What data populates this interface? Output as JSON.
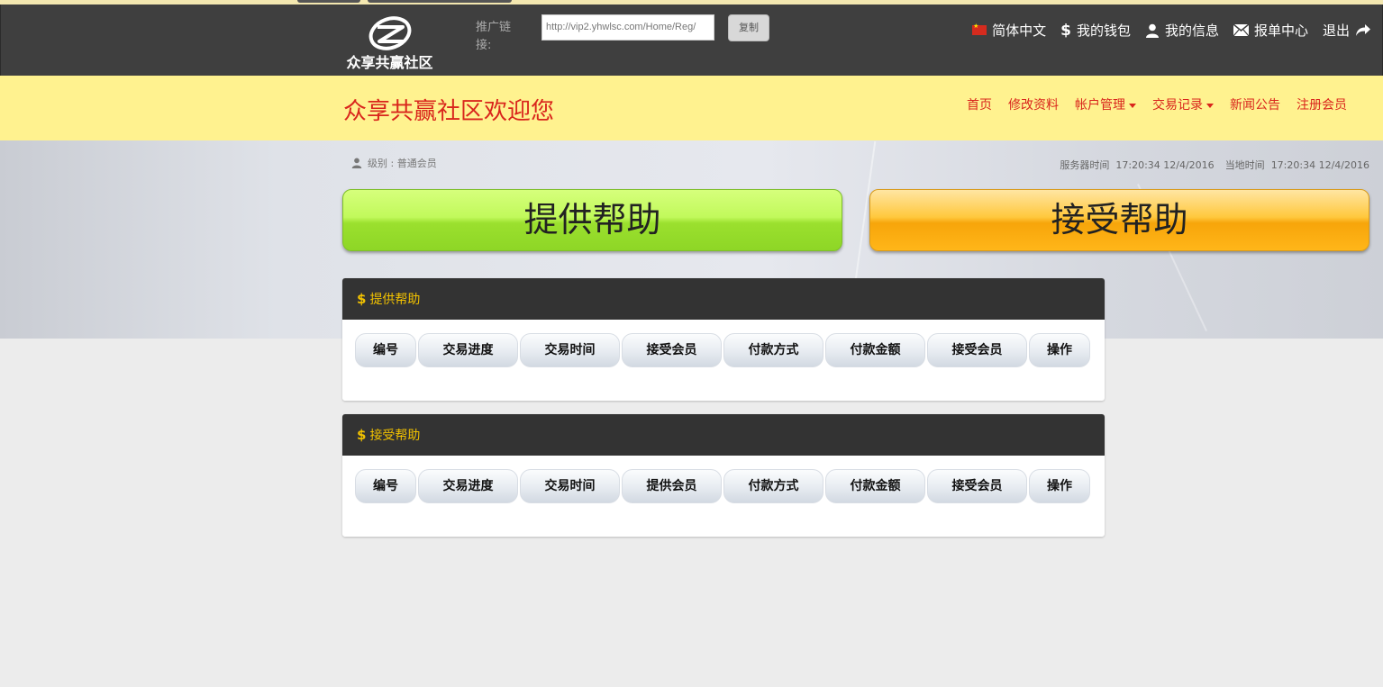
{
  "header": {
    "logo_text": "众享共赢社区",
    "promo_label": "推广链接:",
    "promo_url": "http://vip2.yhwlsc.com/Home/Reg/",
    "copy_label": "复制",
    "nav": [
      {
        "label": "简体中文",
        "icon": "china-flag-icon"
      },
      {
        "label": "我的钱包",
        "icon": "dollar-icon"
      },
      {
        "label": "我的信息",
        "icon": "user-icon"
      },
      {
        "label": "报单中心",
        "icon": "envelope-icon"
      },
      {
        "label": "退出",
        "icon": "share-arrow-icon"
      }
    ]
  },
  "banner": {
    "welcome": "众享共赢社区欢迎您",
    "nav": [
      {
        "label": "首页"
      },
      {
        "label": "修改资料"
      },
      {
        "label": "帐户管理",
        "dropdown": true
      },
      {
        "label": "交易记录",
        "dropdown": true
      },
      {
        "label": "新闻公告"
      },
      {
        "label": "注册会员"
      }
    ],
    "accent_color": "#d9251c",
    "background_color": "#fff28f"
  },
  "status": {
    "level": "级别 : 普通会员",
    "server_time_label": "服务器时间",
    "server_time": "17:20:34 12/4/2016",
    "local_time_label": "当地时间",
    "local_time": "17:20:34 12/4/2016"
  },
  "actions": {
    "provide_help": "提供帮助",
    "receive_help": "接受帮助"
  },
  "panels": [
    {
      "title": "提供帮助",
      "columns": [
        "编号",
        "交易进度",
        "交易时间",
        "接受会员",
        "付款方式",
        "付款金额",
        "接受会员",
        "操作"
      ]
    },
    {
      "title": "接受帮助",
      "columns": [
        "编号",
        "交易进度",
        "交易时间",
        "提供会员",
        "付款方式",
        "付款金额",
        "接受会员",
        "操作"
      ]
    }
  ]
}
